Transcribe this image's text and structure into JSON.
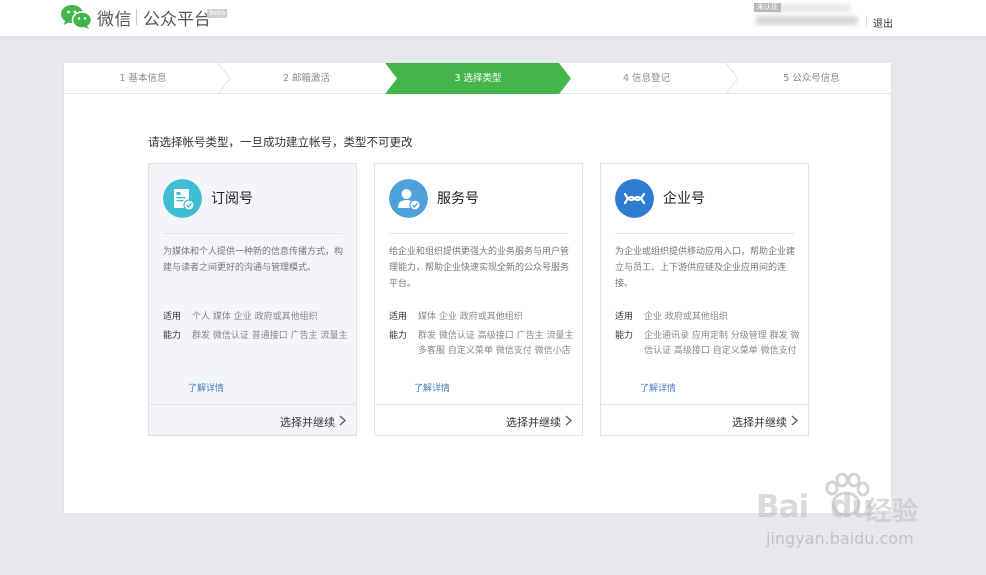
{
  "header": {
    "brand": "微信",
    "platform": "公众平台",
    "beta": "Beta",
    "account_badge": "未认证",
    "logout_label": "退出"
  },
  "steps": [
    {
      "label": "1 基本信息",
      "active": false
    },
    {
      "label": "2 邮箱激活",
      "active": false
    },
    {
      "label": "3 选择类型",
      "active": true
    },
    {
      "label": "4 信息登记",
      "active": false
    },
    {
      "label": "5 公众号信息",
      "active": false
    }
  ],
  "instruction": "请选择帐号类型，一旦成功建立帐号，类型不可更改",
  "cards": [
    {
      "title": "订阅号",
      "icon": "subscription-icon",
      "icon_color": "#3fbdd5",
      "description": "为媒体和个人提供一种新的信息传播方式，构建与读者之间更好的沟通与管理模式。",
      "scope_label": "适用",
      "scope": "个人 媒体 企业 政府或其他组织",
      "ability_label": "能力",
      "ability": "群发 微信认证 普通接口 广告主 流量主",
      "link": "了解详情",
      "action": "选择并继续"
    },
    {
      "title": "服务号",
      "icon": "service-icon",
      "icon_color": "#4fa2d9",
      "description": "给企业和组织提供更强大的业务服务与用户管理能力，帮助企业快速实现全新的公众号服务平台。",
      "scope_label": "适用",
      "scope": "媒体 企业 政府或其他组织",
      "ability_label": "能力",
      "ability": "群发 微信认证 高级接口 广告主 流量主 多客服 自定义菜单 微信支付 微信小店",
      "link": "了解详情",
      "action": "选择并继续"
    },
    {
      "title": "企业号",
      "icon": "enterprise-icon",
      "icon_color": "#2d7dd2",
      "description": "为企业或组织提供移动应用入口，帮助企业建立与员工、上下游供应链及企业应用间的连接。",
      "scope_label": "适用",
      "scope": "企业 政府或其他组织",
      "ability_label": "能力",
      "ability": "企业通讯录 应用定制 分级管理 群发 微信认证 高级接口 自定义菜单 微信支付",
      "link": "了解详情",
      "action": "选择并继续"
    }
  ],
  "watermark": {
    "main": "Bai",
    "main2": "du",
    "cn": "经验",
    "sub": "jingyan.baidu.com"
  },
  "colors": {
    "accent_green": "#44b549",
    "link_blue": "#4a7db8"
  }
}
